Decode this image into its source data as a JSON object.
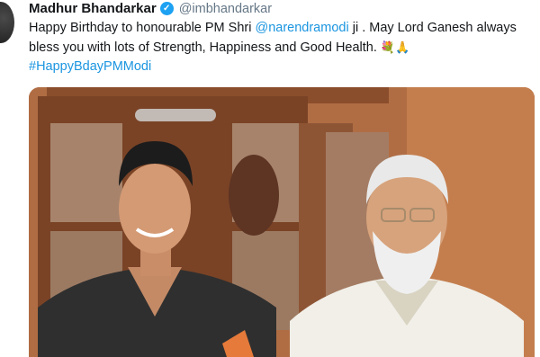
{
  "tweet": {
    "author_name": "Madhur Bhandarkar",
    "verified_icon": "verified-badge-icon",
    "handle": "@imbhandarkar",
    "text_part1": "Happy Birthday to honourable PM Shri ",
    "mention": "@narendramodi",
    "text_part2": " ji . May Lord Ganesh always bless you with lots of Strength, Happiness and Good Health. ",
    "emoji": "💐🙏",
    "hashtag": "#HappyBdayPMModi"
  },
  "colors": {
    "link": "#1b95e0",
    "verified": "#1da1f2",
    "text": "#14171a",
    "muted": "#657786"
  }
}
